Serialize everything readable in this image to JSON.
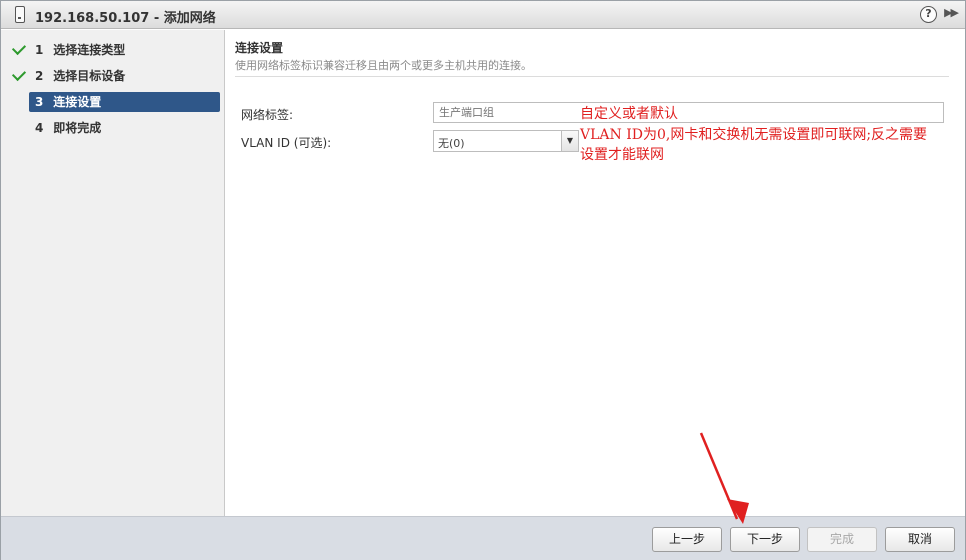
{
  "window": {
    "title": "192.168.50.107 - 添加网络",
    "help_label": "?",
    "expand_label": "▶▶"
  },
  "steps": [
    {
      "num": "1",
      "label": "选择连接类型",
      "completed": true
    },
    {
      "num": "2",
      "label": "选择目标设备",
      "completed": true
    },
    {
      "num": "3",
      "label": "连接设置",
      "active": true
    },
    {
      "num": "4",
      "label": "即将完成"
    }
  ],
  "section": {
    "title": "连接设置",
    "description": "使用网络标签标识兼容迁移且由两个或更多主机共用的连接。"
  },
  "form": {
    "network_label": "网络标签:",
    "network_placeholder": "生产端口组",
    "vlan_label": "VLAN ID (可选):",
    "vlan_value": "无(0)"
  },
  "annotations": {
    "line1": "自定义或者默认",
    "line2": "VLAN ID为0,网卡和交换机无需设置即可联网;反之需要",
    "line3": "设置才能联网",
    "color": "#e02020"
  },
  "buttons": {
    "back": "上一步",
    "next": "下一步",
    "finish": "完成",
    "cancel": "取消"
  }
}
